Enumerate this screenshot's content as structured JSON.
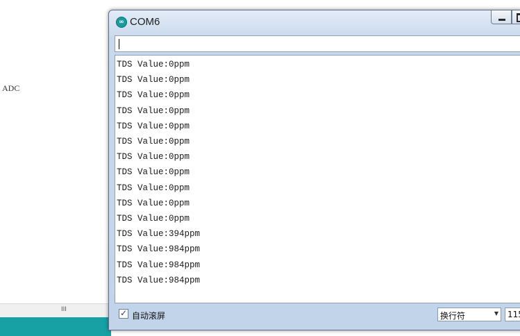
{
  "background": {
    "editor_text": "ADC",
    "scroll_grip": "III"
  },
  "window": {
    "title": "COM6",
    "icon": "arduino-icon"
  },
  "send_field": {
    "value": ""
  },
  "output": {
    "lines": [
      "TDS Value:0ppm",
      "TDS Value:0ppm",
      "TDS Value:0ppm",
      "TDS Value:0ppm",
      "TDS Value:0ppm",
      "TDS Value:0ppm",
      "TDS Value:0ppm",
      "TDS Value:0ppm",
      "TDS Value:0ppm",
      "TDS Value:0ppm",
      "TDS Value:0ppm",
      "TDS Value:394ppm",
      "TDS Value:984ppm",
      "TDS Value:984ppm",
      "TDS Value:984ppm"
    ]
  },
  "status": {
    "autoscroll_label": "自动滚屏",
    "autoscroll_checked": true,
    "line_ending": "换行符",
    "baud": "115"
  },
  "colors": {
    "accent_teal": "#17a1a5",
    "title_bar": "#c9d9ec"
  }
}
